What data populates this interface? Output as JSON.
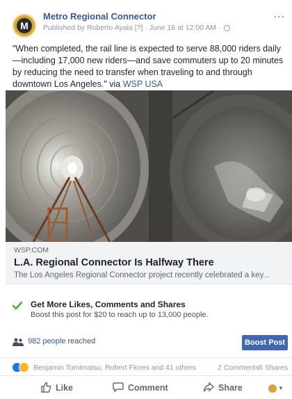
{
  "post": {
    "page_name": "Metro Regional Connector",
    "author_prefix": "Published by",
    "author": "Roberto Ayala",
    "help_marker": "[?]",
    "timestamp": "June 16 at 12:00 AM",
    "more": "...",
    "text": "\"When completed, the rail line is expected to serve 88,000 riders daily—including 17,000 new riders—and save commuters up to 20 minutes by reducing the need to transfer when traveling to and through downtown Los Angeles.\" via",
    "text_link": "WSP USA"
  },
  "link_card": {
    "domain": "WSP.COM",
    "title": "L.A. Regional Connector Is Halfway There",
    "description": "The Los Angeles Regional Connector project recently celebrated a key..."
  },
  "boost_tip": {
    "title": "Get More Likes, Comments and Shares",
    "subtitle": "Boost this post for $20 to reach up to 13,000 people."
  },
  "reach": {
    "count": "982 people",
    "suffix": "reached",
    "boost_button": "Boost Post"
  },
  "reactions": {
    "names": "Benjamin Tomimatsu, Robert Flores and 41 others",
    "comments": "2 Comments",
    "shares": "6 Shares"
  },
  "actions": {
    "like": "Like",
    "comment": "Comment",
    "share": "Share"
  },
  "colors": {
    "link_blue": "#385898",
    "button_blue": "#4267b2",
    "avatar_gold": "#d4a63a",
    "check_green": "#42b72a"
  }
}
